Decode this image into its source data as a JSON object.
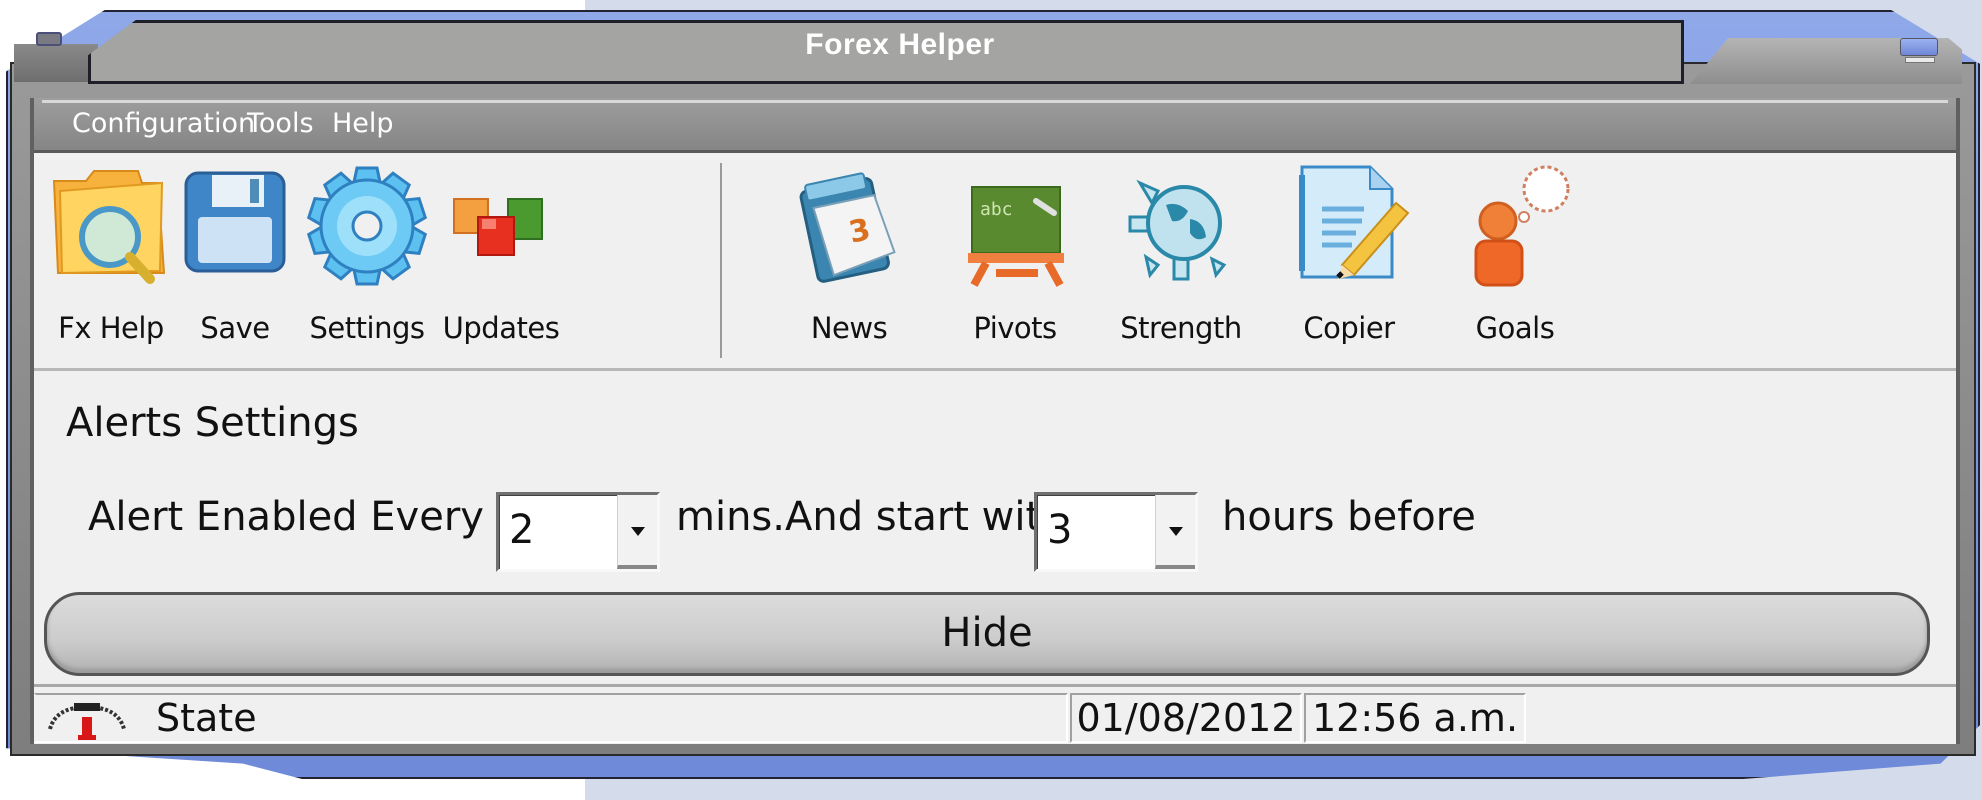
{
  "window": {
    "title": "Forex Helper"
  },
  "menu": {
    "items": [
      {
        "label": "Configuration"
      },
      {
        "label": "Tools"
      },
      {
        "label": "Help"
      }
    ]
  },
  "toolbar": {
    "group1": [
      {
        "label": "Fx Help",
        "icon": "folder-search-icon"
      },
      {
        "label": "Save",
        "icon": "floppy-disk-icon"
      },
      {
        "label": "Settings",
        "icon": "gear-icon"
      },
      {
        "label": "Updates",
        "icon": "blocks-icon"
      }
    ],
    "group2": [
      {
        "label": "News",
        "icon": "calendar-icon"
      },
      {
        "label": "Pivots",
        "icon": "chalkboard-icon"
      },
      {
        "label": "Strength",
        "icon": "globe-gear-icon"
      },
      {
        "label": "Copier",
        "icon": "document-pencil-icon"
      },
      {
        "label": "Goals",
        "icon": "person-thought-icon"
      }
    ]
  },
  "alerts": {
    "section_title": "Alerts Settings",
    "prefix": "Alert Enabled Every",
    "minutes_value": "2",
    "middle": "mins.And start with",
    "hours_value": "3",
    "suffix": "hours before"
  },
  "hide_button": {
    "label": "Hide"
  },
  "status_bar": {
    "state_label": "State",
    "state_icon": "telephone-icon",
    "date": "01/08/2012",
    "time": "12:56 a.m."
  },
  "colors": {
    "frame_accent": "#7a92e0",
    "title_text": "#ffffff",
    "client_bg": "#f0f0f0"
  }
}
